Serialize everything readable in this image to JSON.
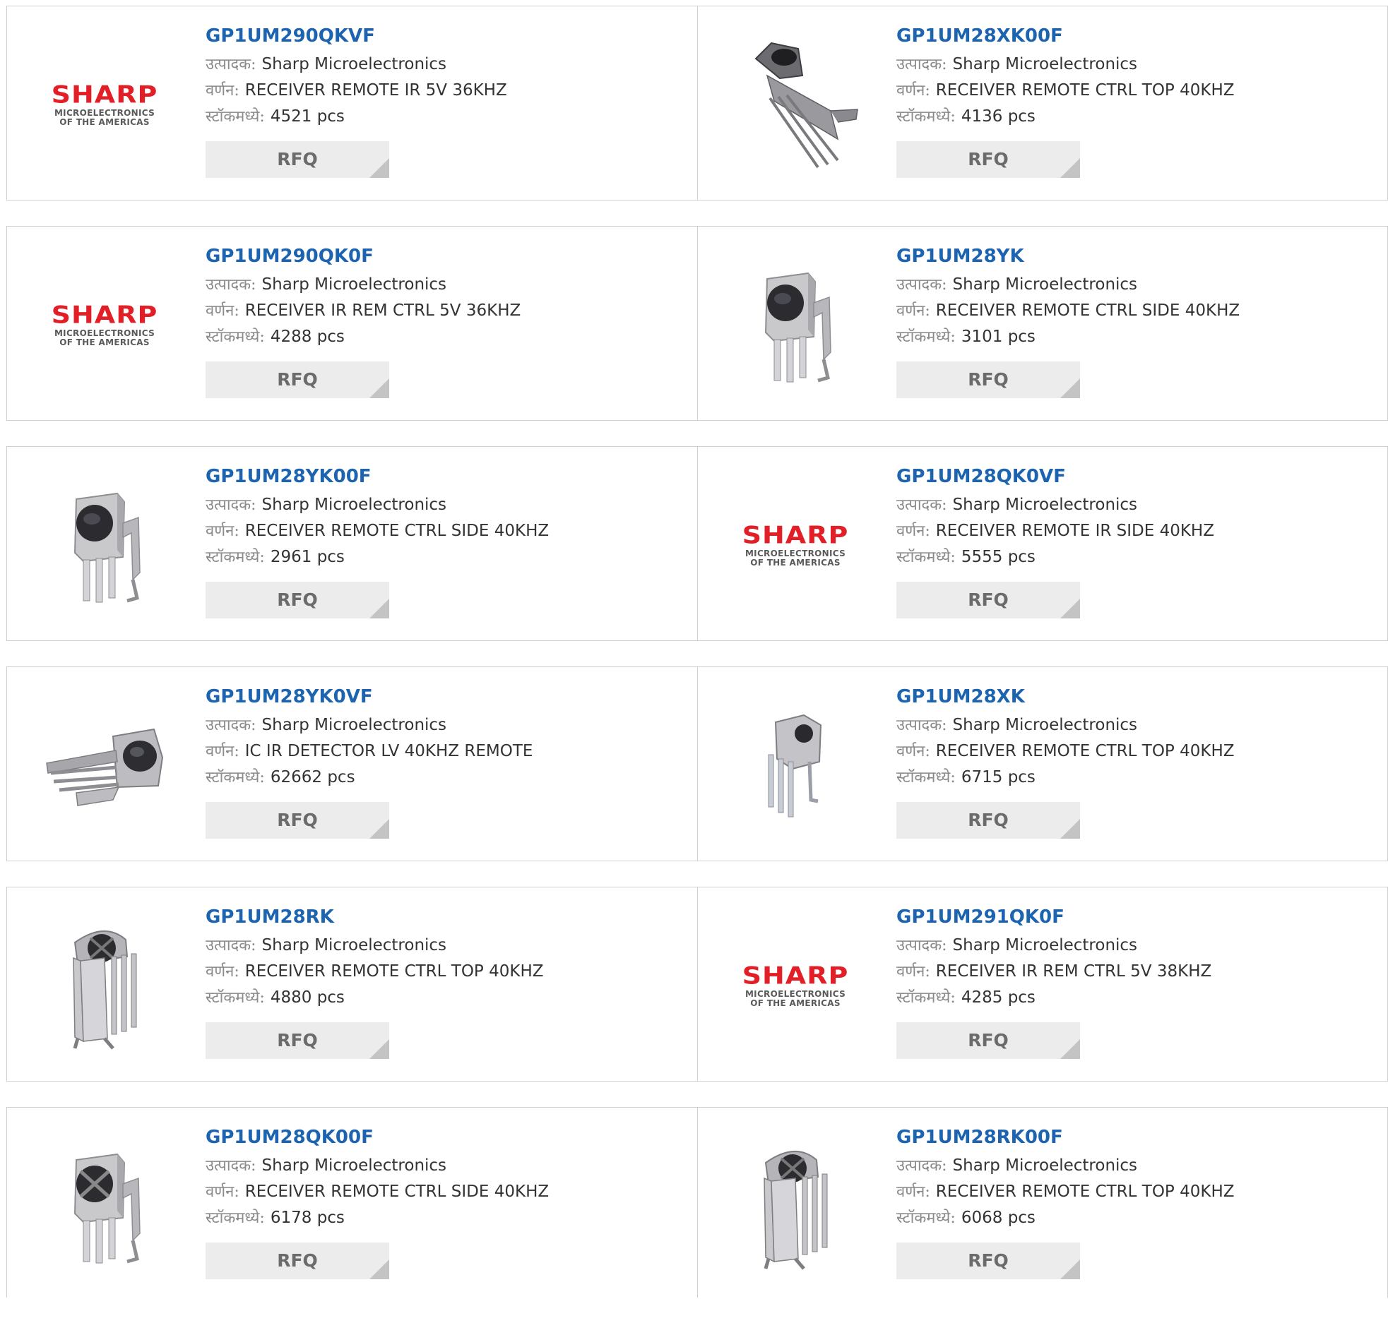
{
  "labels": {
    "manufacturer": "उत्पादक:",
    "description": "वर्णन:",
    "stock": "स्टॉकमध्ये:",
    "rfq": "RFQ"
  },
  "logo": {
    "brand": "SHARP",
    "line1": "MICROELECTRONICS",
    "line2": "OF THE AMERICAS"
  },
  "products": [
    {
      "part": "GP1UM290QKVF",
      "manufacturer": "Sharp Microelectronics",
      "description": "RECEIVER REMOTE IR 5V 36KHZ",
      "stock": "4521 pcs",
      "image": "sharp-logo"
    },
    {
      "part": "GP1UM28XK00F",
      "manufacturer": "Sharp Microelectronics",
      "description": "RECEIVER REMOTE CTRL TOP 40KHZ",
      "stock": "4136 pcs",
      "image": "ir-receiver-top-angled"
    },
    {
      "part": "GP1UM290QK0F",
      "manufacturer": "Sharp Microelectronics",
      "description": "RECEIVER IR REM CTRL 5V 36KHZ",
      "stock": "4288 pcs",
      "image": "sharp-logo"
    },
    {
      "part": "GP1UM28YK",
      "manufacturer": "Sharp Microelectronics",
      "description": "RECEIVER REMOTE CTRL SIDE 40KHZ",
      "stock": "3101 pcs",
      "image": "ir-receiver-side"
    },
    {
      "part": "GP1UM28YK00F",
      "manufacturer": "Sharp Microelectronics",
      "description": "RECEIVER REMOTE CTRL SIDE 40KHZ",
      "stock": "2961 pcs",
      "image": "ir-receiver-side"
    },
    {
      "part": "GP1UM28QK0VF",
      "manufacturer": "Sharp Microelectronics",
      "description": "RECEIVER REMOTE IR SIDE 40KHZ",
      "stock": "5555 pcs",
      "image": "sharp-logo"
    },
    {
      "part": "GP1UM28YK0VF",
      "manufacturer": "Sharp Microelectronics",
      "description": "IC IR DETECTOR LV 40KHZ REMOTE",
      "stock": "62662 pcs",
      "image": "ir-detector-horizontal"
    },
    {
      "part": "GP1UM28XK",
      "manufacturer": "Sharp Microelectronics",
      "description": "RECEIVER REMOTE CTRL TOP 40KHZ",
      "stock": "6715 pcs",
      "image": "ir-receiver-small"
    },
    {
      "part": "GP1UM28RK",
      "manufacturer": "Sharp Microelectronics",
      "description": "RECEIVER REMOTE CTRL TOP 40KHZ",
      "stock": "4880 pcs",
      "image": "ir-receiver-top"
    },
    {
      "part": "GP1UM291QK0F",
      "manufacturer": "Sharp Microelectronics",
      "description": "RECEIVER IR REM CTRL 5V 38KHZ",
      "stock": "4285 pcs",
      "image": "sharp-logo"
    },
    {
      "part": "GP1UM28QK00F",
      "manufacturer": "Sharp Microelectronics",
      "description": "RECEIVER REMOTE CTRL SIDE 40KHZ",
      "stock": "6178 pcs",
      "image": "ir-receiver-side-cross"
    },
    {
      "part": "GP1UM28RK00F",
      "manufacturer": "Sharp Microelectronics",
      "description": "RECEIVER REMOTE CTRL TOP 40KHZ",
      "stock": "6068 pcs",
      "image": "ir-receiver-top"
    }
  ]
}
